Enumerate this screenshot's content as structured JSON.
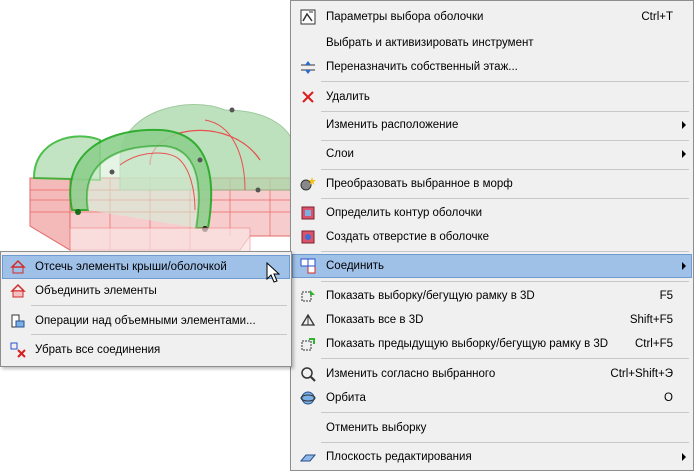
{
  "menu": {
    "items": [
      {
        "label": "Параметры выбора оболочки",
        "shortcut": "Ctrl+T",
        "icon": "shell-settings-icon"
      },
      {
        "label": "Выбрать и активизировать инструмент",
        "shortcut": "",
        "icon": ""
      },
      {
        "label": "Переназначить собственный этаж...",
        "shortcut": "",
        "icon": "story-reassign-icon"
      },
      {
        "label": "Удалить",
        "shortcut": "",
        "icon": "delete-icon"
      },
      {
        "label": "Изменить расположение",
        "shortcut": "",
        "icon": "",
        "submenu": true
      },
      {
        "label": "Слои",
        "shortcut": "",
        "icon": "",
        "submenu": true
      },
      {
        "label": "Преобразовать выбранное в морф",
        "shortcut": "",
        "icon": "convert-morph-icon"
      },
      {
        "label": "Определить контур оболочки",
        "shortcut": "",
        "icon": "shell-contour-icon"
      },
      {
        "label": "Создать отверстие в оболочке",
        "shortcut": "",
        "icon": "shell-hole-icon"
      },
      {
        "label": "Соединить",
        "shortcut": "",
        "icon": "connect-icon",
        "submenu": true
      },
      {
        "label": "Показать выборку/бегущую рамку в 3D",
        "shortcut": "F5",
        "icon": "show-selection-3d-icon"
      },
      {
        "label": "Показать все в 3D",
        "shortcut": "Shift+F5",
        "icon": "show-all-3d-icon"
      },
      {
        "label": "Показать предыдущую выборку/бегущую рамку в 3D",
        "shortcut": "Ctrl+F5",
        "icon": "show-previous-3d-icon"
      },
      {
        "label": "Изменить согласно выбранного",
        "shortcut": "Ctrl+Shift+Э",
        "icon": "match-selection-icon"
      },
      {
        "label": "Орбита",
        "shortcut": "O",
        "icon": "orbit-icon"
      },
      {
        "label": "Отменить выборку",
        "shortcut": "",
        "icon": ""
      },
      {
        "label": "Плоскость редактирования",
        "shortcut": "",
        "icon": "edit-plane-icon",
        "submenu": true
      }
    ]
  },
  "submenu": {
    "items": [
      {
        "label": "Отсечь элементы крыши/оболочкой",
        "icon": "trim-roof-icon"
      },
      {
        "label": "Объединить элементы",
        "icon": "merge-elements-icon"
      },
      {
        "label": "Операции над объемными элементами...",
        "icon": "solid-operations-icon"
      },
      {
        "label": "Убрать все соединения",
        "icon": "remove-connections-icon"
      }
    ]
  },
  "colors": {
    "highlight": "#9fc1e8",
    "menu_bg": "#f0f0f0",
    "shell_green": "#2db52d",
    "cut_red": "#e33b3b"
  }
}
